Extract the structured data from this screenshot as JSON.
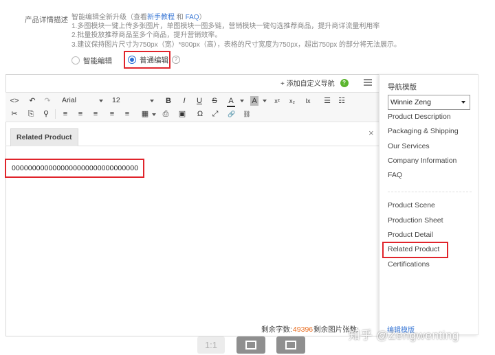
{
  "section": {
    "label": "产品详情描述",
    "intro_prefix": "智能编辑全新升级（查看",
    "intro_link": "新手教程",
    "intro_and": " 和 ",
    "intro_faq": "FAQ",
    "intro_suffix": "）",
    "tips": [
      "1.多图模块一键上传多张图片，单图模块一图多链，营销模块一键勾选推荐商品，提升商详流量利用率",
      "2.批量投放推荐商品至多个商品，提升营销效率。",
      "3.建议保持图片尺寸为750px（宽）*800px（高），表格的尺寸宽度为750px，超出750px 的部分将无法展示。"
    ]
  },
  "modes": {
    "smart": "智能编辑",
    "normal": "普通编辑",
    "selected": "普通编辑",
    "help": "?"
  },
  "editor": {
    "add_nav": "+ 添加自定义导航",
    "help": "?",
    "font": "Arial",
    "size": "12",
    "tab": "Related Product",
    "close": "×",
    "content": "0000000000000000000000000000000",
    "footer_chars_label": "剩余字数:",
    "footer_chars_value": "49396",
    "footer_images_label": "剩余图片张数:"
  },
  "toolbar": {
    "row1": [
      "<>",
      "↶",
      "↷",
      "B",
      "I",
      "U",
      "S",
      "A",
      "A",
      "x²",
      "x₂",
      "Ix",
      "☰",
      "☷"
    ],
    "row2": [
      "✂",
      "⎘",
      "⚲",
      "≡",
      "≡",
      "≡",
      "≡",
      "≡",
      "▦",
      "⎙",
      "▣",
      "Ω",
      "⤢",
      "🔗",
      "⛓"
    ]
  },
  "nav_panel": {
    "title": "导航模版",
    "selected_template": "Winnie Zeng",
    "items_top": [
      "Product Description",
      "Packaging & Shipping",
      "Our Services",
      "Company Information",
      "FAQ"
    ],
    "items_bottom": [
      "Product Scene",
      "Production Sheet",
      "Product Detail",
      "Related Product",
      "Certifications"
    ],
    "partial_bottom": "编辑模版"
  },
  "bottom_controls": {
    "actual_size": "1:1"
  },
  "watermark": "知乎 @Zengwenting"
}
